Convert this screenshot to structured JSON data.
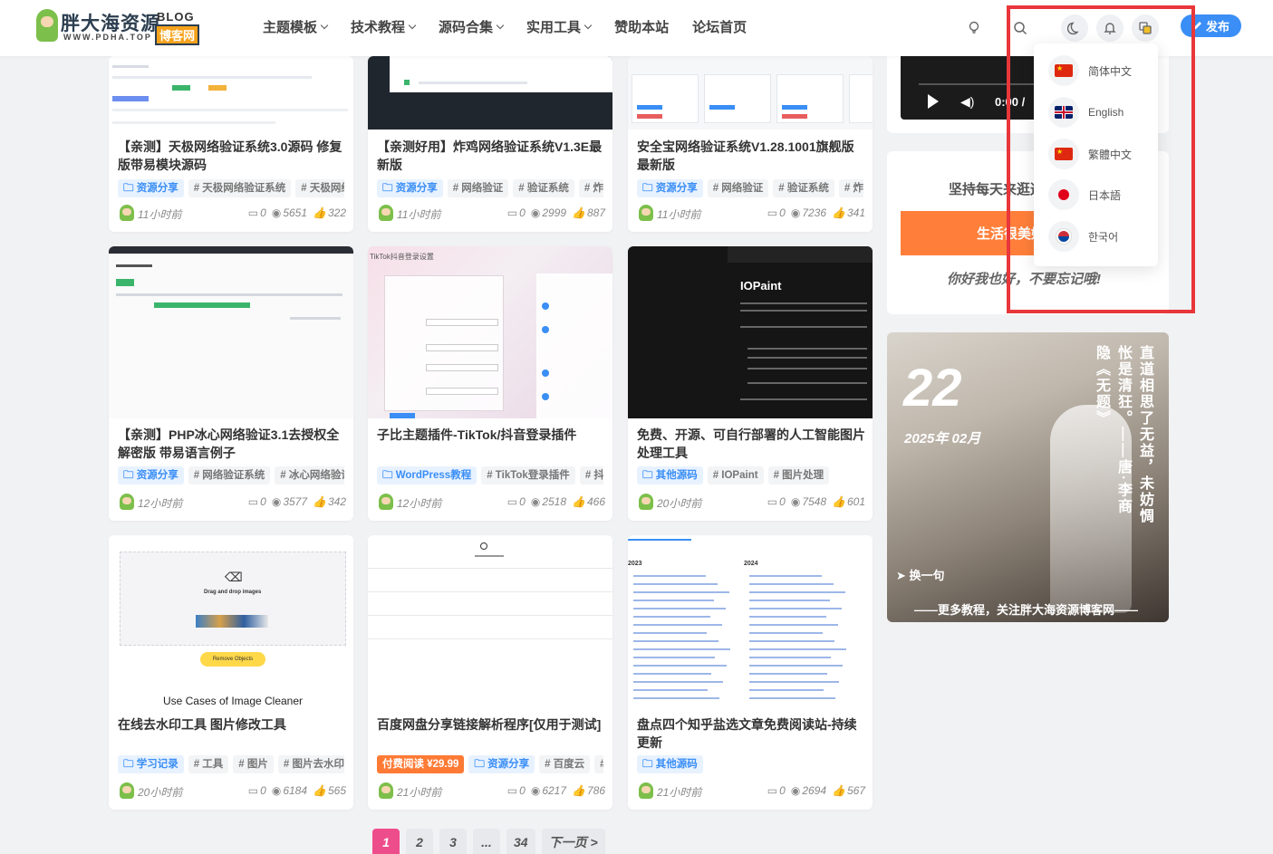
{
  "header": {
    "logo_main": "胖大海资源",
    "logo_blog": "BLOG",
    "logo_badge": "博客网",
    "logo_sub": "WWW.PDHA.TOP",
    "nav": [
      {
        "label": "主题模板",
        "has_menu": true
      },
      {
        "label": "技术教程",
        "has_menu": true
      },
      {
        "label": "源码合集",
        "has_menu": true
      },
      {
        "label": "实用工具",
        "has_menu": true
      },
      {
        "label": "赞助本站",
        "has_menu": false
      },
      {
        "label": "论坛首页",
        "has_menu": false
      }
    ],
    "publish_label": "发布",
    "icons": [
      "lightbulb-icon",
      "search-icon",
      "moon-icon",
      "bell-icon",
      "translate-icon"
    ]
  },
  "lang_menu": [
    {
      "label": "简体中文",
      "flag": "china"
    },
    {
      "label": "English",
      "flag": "uk"
    },
    {
      "label": "繁體中文",
      "flag": "china"
    },
    {
      "label": "日本語",
      "flag": "japan"
    },
    {
      "label": "한국어",
      "flag": "korea"
    }
  ],
  "cards": [
    {
      "title": "【亲测】天极网络验证系统3.0源码 修复版带易模块源码",
      "tags": [
        {
          "t": "资源分享",
          "k": "cat"
        },
        {
          "t": "# 天极网络验证系统",
          "k": "topic"
        },
        {
          "t": "# 天极网络",
          "k": "topic"
        }
      ],
      "time": "11小时前",
      "comments": "0",
      "views": "5651",
      "likes": "322"
    },
    {
      "title": "【亲测好用】炸鸡网络验证系统V1.3E最新版",
      "tags": [
        {
          "t": "资源分享",
          "k": "cat"
        },
        {
          "t": "# 网络验证",
          "k": "topic"
        },
        {
          "t": "# 验证系统",
          "k": "topic"
        },
        {
          "t": "# 炸",
          "k": "topic"
        }
      ],
      "time": "11小时前",
      "comments": "0",
      "views": "2999",
      "likes": "887"
    },
    {
      "title": "安全宝网络验证系统V1.28.1001旗舰版最新版",
      "tags": [
        {
          "t": "资源分享",
          "k": "cat"
        },
        {
          "t": "# 网络验证",
          "k": "topic"
        },
        {
          "t": "# 验证系统",
          "k": "topic"
        },
        {
          "t": "# 炸",
          "k": "topic"
        }
      ],
      "time": "11小时前",
      "comments": "0",
      "views": "7236",
      "likes": "341"
    },
    {
      "title": "【亲测】PHP冰心网络验证3.1去授权全解密版 带易语言例子",
      "tags": [
        {
          "t": "资源分享",
          "k": "cat"
        },
        {
          "t": "# 网络验证系统",
          "k": "topic"
        },
        {
          "t": "# 冰心网络验证",
          "k": "topic"
        }
      ],
      "time": "12小时前",
      "comments": "0",
      "views": "3577",
      "likes": "342"
    },
    {
      "title": "子比主题插件-TikTok/抖音登录插件",
      "tags": [
        {
          "t": "WordPress教程",
          "k": "cat"
        },
        {
          "t": "# TikTok登录插件",
          "k": "topic"
        },
        {
          "t": "# 抖音",
          "k": "topic"
        }
      ],
      "time": "12小时前",
      "comments": "0",
      "views": "2518",
      "likes": "466"
    },
    {
      "title": "免费、开源、可自行部署的人工智能图片处理工具",
      "tags": [
        {
          "t": "其他源码",
          "k": "cat"
        },
        {
          "t": "# IOPaint",
          "k": "topic"
        },
        {
          "t": "# 图片处理",
          "k": "topic"
        }
      ],
      "time": "20小时前",
      "comments": "0",
      "views": "7548",
      "likes": "601"
    },
    {
      "title": "在线去水印工具 图片修改工具",
      "tags": [
        {
          "t": "学习记录",
          "k": "cat"
        },
        {
          "t": "# 工具",
          "k": "topic"
        },
        {
          "t": "# 图片",
          "k": "topic"
        },
        {
          "t": "# 图片去水印",
          "k": "topic"
        }
      ],
      "time": "20小时前",
      "comments": "0",
      "views": "6184",
      "likes": "565"
    },
    {
      "title": "百度网盘分享链接解析程序[仅用于测试]",
      "tags": [
        {
          "t": "付费阅读 ¥29.99",
          "k": "pay"
        },
        {
          "t": "资源分享",
          "k": "cat"
        },
        {
          "t": "# 百度云",
          "k": "topic"
        },
        {
          "t": "#",
          "k": "topic"
        }
      ],
      "time": "21小时前",
      "comments": "0",
      "views": "6217",
      "likes": "786"
    },
    {
      "title": "盘点四个知乎盐选文章免费阅读站-持续更新",
      "tags": [
        {
          "t": "其他源码",
          "k": "cat"
        }
      ],
      "time": "21小时前",
      "comments": "0",
      "views": "2694",
      "likes": "567"
    }
  ],
  "thumb_text": {
    "tiktok_heading": "TikTok抖音登录设置",
    "iopaint_title": "IOPaint",
    "cleaner_drag": "Drag and drop images",
    "cleaner_button": "Remove Objects",
    "cleaner_caption": "Use Cases of Image Cleaner",
    "zhihu_col1": "2023",
    "zhihu_col2": "2024"
  },
  "sidebar": {
    "video_time": "0:00 /",
    "motto": "坚持每天来逛逛",
    "orange_btn": "生活很美好",
    "greeting": "你好我也好，不要忘记哦!",
    "poster": {
      "day": "22",
      "month": "2025年 02月",
      "poem_a": "直道相思了无益，未妨惆",
      "poem_b": "怅是清狂。——唐·李商",
      "poem_c": "隐《无题》",
      "refresh": "换一句",
      "footer": "——更多教程，关注胖大海资源博客网——"
    }
  },
  "pagination": [
    "1",
    "2",
    "3",
    "...",
    "34",
    "下一页 >"
  ],
  "colors": {
    "accent": "#3a8ef6",
    "pink": "#ee4d8c",
    "orange": "#ff7f3a",
    "highlight": "#e8363a"
  }
}
